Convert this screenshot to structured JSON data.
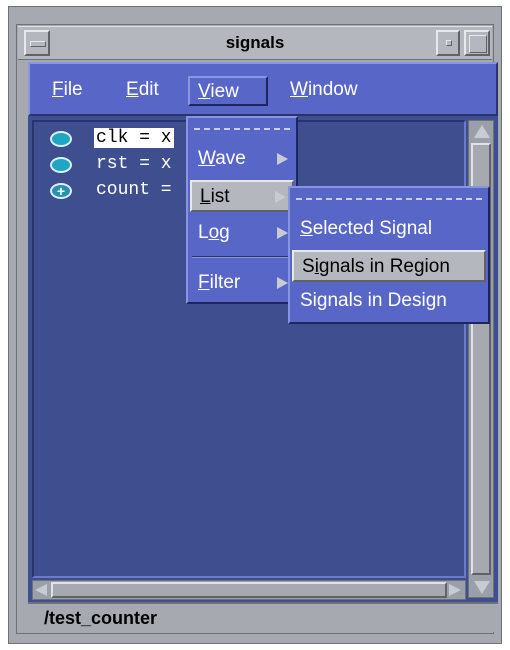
{
  "window": {
    "title": "signals"
  },
  "menubar": {
    "items": [
      {
        "label": "File",
        "mnemonic": "F",
        "rest": "ile"
      },
      {
        "label": "Edit",
        "mnemonic": "E",
        "rest": "dit"
      },
      {
        "label": "View",
        "mnemonic": "V",
        "rest": "iew"
      },
      {
        "label": "Window",
        "mnemonic": "W",
        "rest": "indow"
      }
    ]
  },
  "view_menu": {
    "items": [
      {
        "label": "Wave",
        "pre": "",
        "mnemonic": "W",
        "rest": "ave"
      },
      {
        "label": "List",
        "pre": "",
        "mnemonic": "L",
        "rest": "ist"
      },
      {
        "label": "Log",
        "pre": "L",
        "mnemonic": "o",
        "rest": "g"
      },
      {
        "label": "Filter",
        "pre": "",
        "mnemonic": "F",
        "rest": "ilter"
      }
    ]
  },
  "list_submenu": {
    "items": [
      {
        "label": "Selected Signal",
        "pre": "",
        "mnemonic": "S",
        "rest": "elected Signal"
      },
      {
        "label": "Signals in Region",
        "pre": "S",
        "mnemonic": "i",
        "rest": "gnals in Region"
      },
      {
        "label": "Signals in Design",
        "pre": "Si",
        "mnemonic": "g",
        "rest": "nals in Design"
      }
    ]
  },
  "signals": [
    {
      "label": "clk = x",
      "icon": "signal-icon"
    },
    {
      "label": "rst = x",
      "icon": "signal-icon"
    },
    {
      "label": "count =",
      "icon": "expand-plus-icon"
    }
  ],
  "status": {
    "region": "/test_counter"
  },
  "colors": {
    "menu_bg": "#5866c8",
    "pane_bg": "#3f4e8e",
    "chrome": "#a6aab0",
    "signal_icon": "#1fa6c4"
  }
}
